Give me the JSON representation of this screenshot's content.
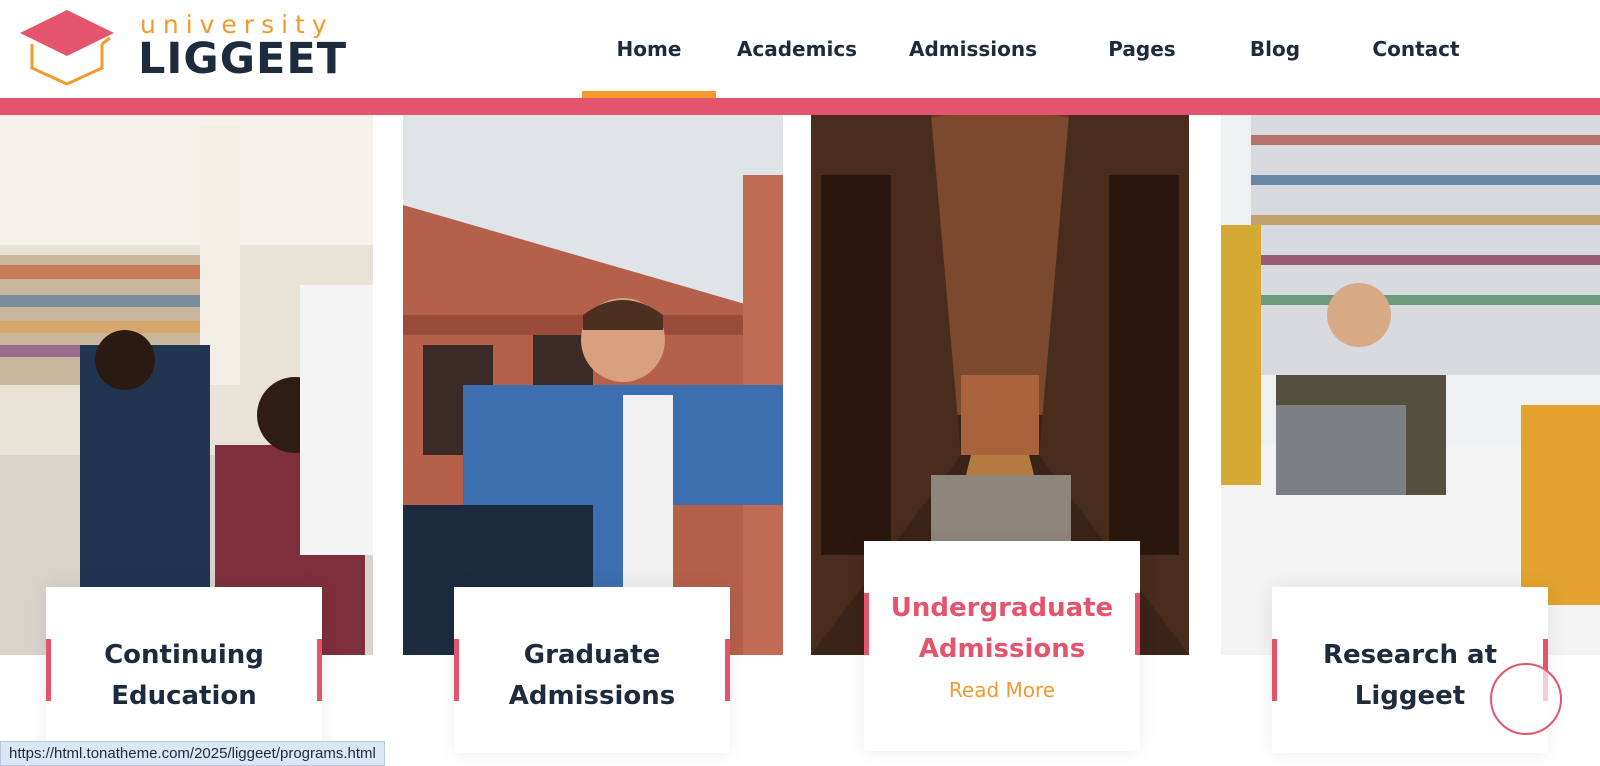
{
  "brand": {
    "small": "university",
    "big": "LIGGEET",
    "colors": {
      "primary": "#e5546d",
      "accent": "#f29a2e",
      "dark": "#1d2b3c"
    }
  },
  "nav": [
    {
      "label": "Home",
      "active": true
    },
    {
      "label": "Academics"
    },
    {
      "label": "Admissions"
    },
    {
      "label": "Pages"
    },
    {
      "label": "Blog"
    },
    {
      "label": "Contact"
    }
  ],
  "cards": [
    {
      "title_line1": "Continuing",
      "title_line2": "Education",
      "image": "students-high-five-library"
    },
    {
      "title_line1": "Graduate",
      "title_line2": "Admissions",
      "image": "student-at-brick-building"
    },
    {
      "title_line1": "Undergraduate",
      "title_line2": "Admissions",
      "link": "Read More",
      "active": true,
      "image": "long-arched-library-hall"
    },
    {
      "title_line1": "Research at",
      "title_line2": "Liggeet",
      "image": "students-studying-laptop"
    }
  ],
  "status_url": "https://html.tonatheme.com/2025/liggeet/programs.html"
}
